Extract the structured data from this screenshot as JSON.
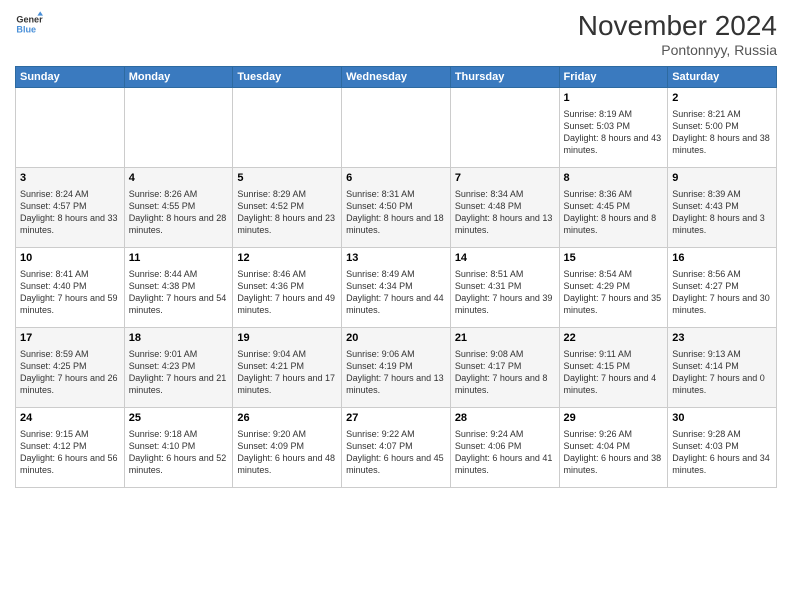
{
  "logo": {
    "line1": "General",
    "line2": "Blue"
  },
  "title": "November 2024",
  "subtitle": "Pontonnyy, Russia",
  "days_of_week": [
    "Sunday",
    "Monday",
    "Tuesday",
    "Wednesday",
    "Thursday",
    "Friday",
    "Saturday"
  ],
  "weeks": [
    [
      {
        "day": "",
        "info": ""
      },
      {
        "day": "",
        "info": ""
      },
      {
        "day": "",
        "info": ""
      },
      {
        "day": "",
        "info": ""
      },
      {
        "day": "",
        "info": ""
      },
      {
        "day": "1",
        "info": "Sunrise: 8:19 AM\nSunset: 5:03 PM\nDaylight: 8 hours and 43 minutes."
      },
      {
        "day": "2",
        "info": "Sunrise: 8:21 AM\nSunset: 5:00 PM\nDaylight: 8 hours and 38 minutes."
      }
    ],
    [
      {
        "day": "3",
        "info": "Sunrise: 8:24 AM\nSunset: 4:57 PM\nDaylight: 8 hours and 33 minutes."
      },
      {
        "day": "4",
        "info": "Sunrise: 8:26 AM\nSunset: 4:55 PM\nDaylight: 8 hours and 28 minutes."
      },
      {
        "day": "5",
        "info": "Sunrise: 8:29 AM\nSunset: 4:52 PM\nDaylight: 8 hours and 23 minutes."
      },
      {
        "day": "6",
        "info": "Sunrise: 8:31 AM\nSunset: 4:50 PM\nDaylight: 8 hours and 18 minutes."
      },
      {
        "day": "7",
        "info": "Sunrise: 8:34 AM\nSunset: 4:48 PM\nDaylight: 8 hours and 13 minutes."
      },
      {
        "day": "8",
        "info": "Sunrise: 8:36 AM\nSunset: 4:45 PM\nDaylight: 8 hours and 8 minutes."
      },
      {
        "day": "9",
        "info": "Sunrise: 8:39 AM\nSunset: 4:43 PM\nDaylight: 8 hours and 3 minutes."
      }
    ],
    [
      {
        "day": "10",
        "info": "Sunrise: 8:41 AM\nSunset: 4:40 PM\nDaylight: 7 hours and 59 minutes."
      },
      {
        "day": "11",
        "info": "Sunrise: 8:44 AM\nSunset: 4:38 PM\nDaylight: 7 hours and 54 minutes."
      },
      {
        "day": "12",
        "info": "Sunrise: 8:46 AM\nSunset: 4:36 PM\nDaylight: 7 hours and 49 minutes."
      },
      {
        "day": "13",
        "info": "Sunrise: 8:49 AM\nSunset: 4:34 PM\nDaylight: 7 hours and 44 minutes."
      },
      {
        "day": "14",
        "info": "Sunrise: 8:51 AM\nSunset: 4:31 PM\nDaylight: 7 hours and 39 minutes."
      },
      {
        "day": "15",
        "info": "Sunrise: 8:54 AM\nSunset: 4:29 PM\nDaylight: 7 hours and 35 minutes."
      },
      {
        "day": "16",
        "info": "Sunrise: 8:56 AM\nSunset: 4:27 PM\nDaylight: 7 hours and 30 minutes."
      }
    ],
    [
      {
        "day": "17",
        "info": "Sunrise: 8:59 AM\nSunset: 4:25 PM\nDaylight: 7 hours and 26 minutes."
      },
      {
        "day": "18",
        "info": "Sunrise: 9:01 AM\nSunset: 4:23 PM\nDaylight: 7 hours and 21 minutes."
      },
      {
        "day": "19",
        "info": "Sunrise: 9:04 AM\nSunset: 4:21 PM\nDaylight: 7 hours and 17 minutes."
      },
      {
        "day": "20",
        "info": "Sunrise: 9:06 AM\nSunset: 4:19 PM\nDaylight: 7 hours and 13 minutes."
      },
      {
        "day": "21",
        "info": "Sunrise: 9:08 AM\nSunset: 4:17 PM\nDaylight: 7 hours and 8 minutes."
      },
      {
        "day": "22",
        "info": "Sunrise: 9:11 AM\nSunset: 4:15 PM\nDaylight: 7 hours and 4 minutes."
      },
      {
        "day": "23",
        "info": "Sunrise: 9:13 AM\nSunset: 4:14 PM\nDaylight: 7 hours and 0 minutes."
      }
    ],
    [
      {
        "day": "24",
        "info": "Sunrise: 9:15 AM\nSunset: 4:12 PM\nDaylight: 6 hours and 56 minutes."
      },
      {
        "day": "25",
        "info": "Sunrise: 9:18 AM\nSunset: 4:10 PM\nDaylight: 6 hours and 52 minutes."
      },
      {
        "day": "26",
        "info": "Sunrise: 9:20 AM\nSunset: 4:09 PM\nDaylight: 6 hours and 48 minutes."
      },
      {
        "day": "27",
        "info": "Sunrise: 9:22 AM\nSunset: 4:07 PM\nDaylight: 6 hours and 45 minutes."
      },
      {
        "day": "28",
        "info": "Sunrise: 9:24 AM\nSunset: 4:06 PM\nDaylight: 6 hours and 41 minutes."
      },
      {
        "day": "29",
        "info": "Sunrise: 9:26 AM\nSunset: 4:04 PM\nDaylight: 6 hours and 38 minutes."
      },
      {
        "day": "30",
        "info": "Sunrise: 9:28 AM\nSunset: 4:03 PM\nDaylight: 6 hours and 34 minutes."
      }
    ]
  ]
}
